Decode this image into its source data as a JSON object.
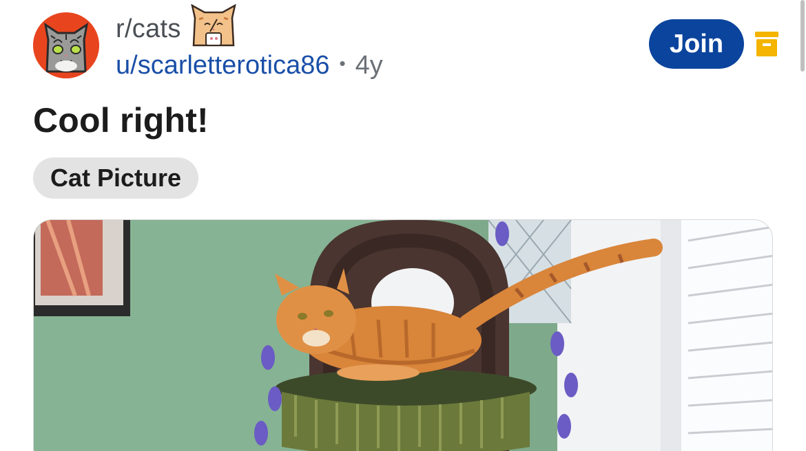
{
  "post": {
    "subreddit": "r/cats",
    "author": "u/scarletterotica86",
    "separator": "•",
    "age": "4y",
    "title": "Cool right!",
    "flair": "Cat Picture",
    "join_label": "Join"
  },
  "icons": {
    "subreddit_avatar": "subreddit-cat-avatar-icon",
    "user_flair": "cat-emoji-icon",
    "archive": "archive-icon"
  },
  "colors": {
    "join_button": "#0b449d",
    "username": "#1a4fa8",
    "archive_icon": "#f4b400",
    "avatar_bg": "#e8451f",
    "flair_chip_bg": "#e3e3e3"
  }
}
